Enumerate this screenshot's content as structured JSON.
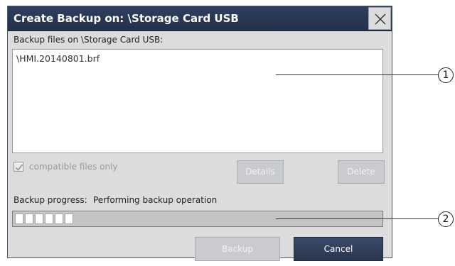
{
  "window": {
    "title": "Create Backup on: \\Storage Card USB",
    "close_glyph": "✕"
  },
  "files": {
    "label": "Backup files on \\Storage Card USB:",
    "items": [
      "\\HMI.20140801.brf"
    ]
  },
  "options": {
    "compatible_only_label": "compatible files only",
    "compatible_only_checked": true,
    "details_label": "Details",
    "delete_label": "Delete"
  },
  "progress": {
    "label": "Backup progress:",
    "status": "Performing backup operation",
    "filled_segments": 6
  },
  "footer": {
    "backup_label": "Backup",
    "cancel_label": "Cancel"
  },
  "callouts": [
    "1",
    "2"
  ],
  "colors": {
    "titlebar": "#2f3f5e",
    "dialog_bg": "#dcdcdc",
    "button_disabled": "#c9cbcf",
    "button_dark": "#2e3d5a"
  }
}
